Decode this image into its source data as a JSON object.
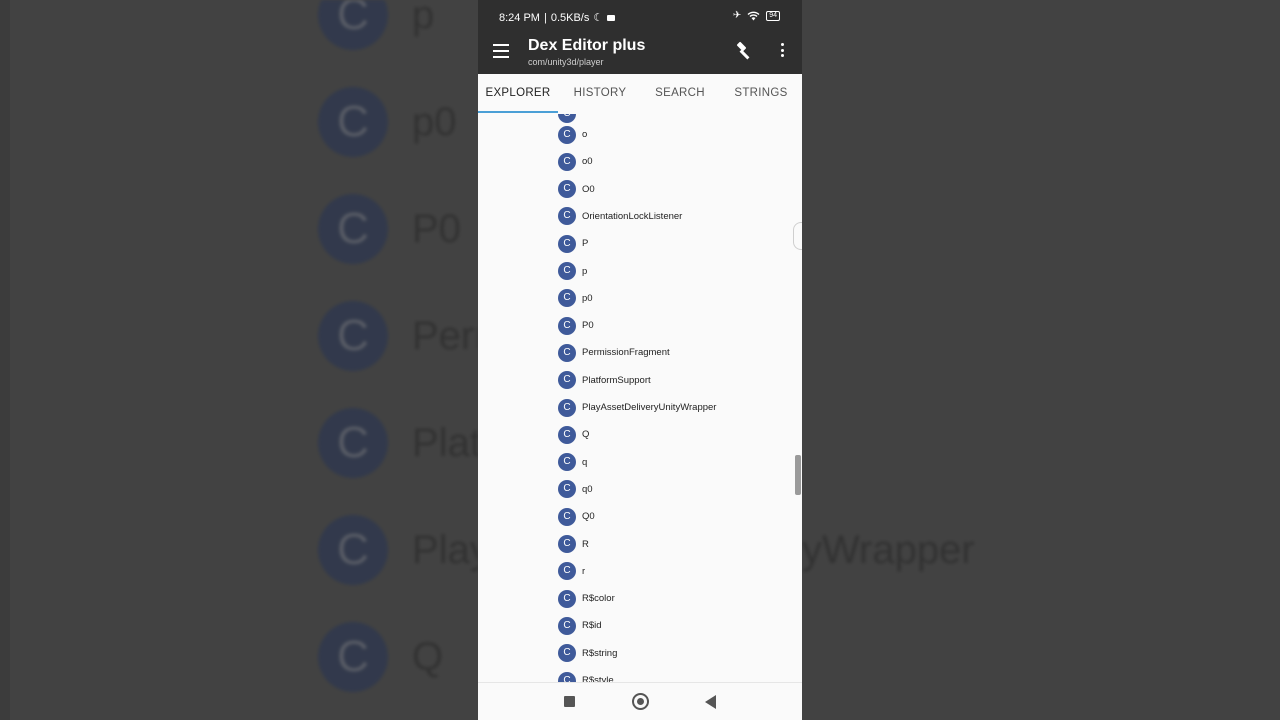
{
  "background": {
    "rows": [
      {
        "label": "p"
      },
      {
        "label": "p0"
      },
      {
        "label": "P0"
      },
      {
        "label": "Perr"
      },
      {
        "label": "Plat"
      },
      {
        "label": "Play"
      },
      {
        "label": "Q"
      }
    ],
    "right_rows": [
      {
        "label": "yWrapper"
      }
    ],
    "badge_letter": "C"
  },
  "status_bar": {
    "time": "8:24 PM",
    "separator": "|",
    "speed": "0.5KB/s",
    "battery": "94"
  },
  "app_bar": {
    "title": "Dex Editor plus",
    "subtitle": "com/unity3d/player",
    "icons": [
      "menu-icon",
      "hammer-icon",
      "more-vert-icon"
    ]
  },
  "tabs": [
    {
      "label": "EXPLORER",
      "active": true
    },
    {
      "label": "HISTORY",
      "active": false
    },
    {
      "label": "SEARCH",
      "active": false
    },
    {
      "label": "STRINGS",
      "active": false
    }
  ],
  "list": {
    "badge_letter": "C",
    "items": [
      "o",
      "o0",
      "O0",
      "OrientationLockListener",
      "P",
      "p",
      "p0",
      "P0",
      "PermissionFragment",
      "PlatformSupport",
      "PlayAssetDeliveryUnityWrapper",
      "Q",
      "q",
      "q0",
      "Q0",
      "R",
      "r",
      "R$color",
      "R$id",
      "R$string",
      "R$style"
    ]
  },
  "colors": {
    "badge": "#3f5a9a",
    "appbar": "#2f2f2f",
    "tab_indicator": "#4a9fd6"
  }
}
